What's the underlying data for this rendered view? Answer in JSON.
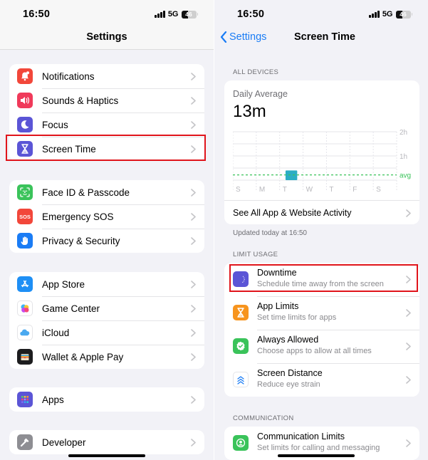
{
  "status_bar": {
    "time": "16:50",
    "network": "5G",
    "battery": "46"
  },
  "left": {
    "nav_title": "Settings",
    "groups": [
      {
        "items": [
          {
            "label": "Notifications",
            "icon": "bell-icon",
            "color": "#f2473a"
          },
          {
            "label": "Sounds & Haptics",
            "icon": "speaker-icon",
            "color": "#f03a5a"
          },
          {
            "label": "Focus",
            "icon": "moon-icon",
            "color": "#5b55d6"
          },
          {
            "label": "Screen Time",
            "icon": "hourglass-icon",
            "color": "#5b55d6",
            "highlighted": true
          }
        ]
      },
      {
        "items": [
          {
            "label": "Face ID & Passcode",
            "icon": "faceid-icon",
            "color": "#3ac35a"
          },
          {
            "label": "Emergency SOS",
            "icon": "sos-icon",
            "color": "#f2473a",
            "icon_text": "SOS"
          },
          {
            "label": "Privacy & Security",
            "icon": "hand-icon",
            "color": "#1a7cf5"
          }
        ]
      },
      {
        "items": [
          {
            "label": "App Store",
            "icon": "appstore-icon",
            "color": "#1e8ff5"
          },
          {
            "label": "Game Center",
            "icon": "gamecenter-icon",
            "color": "#ffffff"
          },
          {
            "label": "iCloud",
            "icon": "cloud-icon",
            "color": "#ffffff"
          },
          {
            "label": "Wallet & Apple Pay",
            "icon": "wallet-icon",
            "color": "#1c1c1e"
          }
        ]
      },
      {
        "items": [
          {
            "label": "Apps",
            "icon": "apps-grid-icon",
            "color": "#5b55d6"
          }
        ]
      },
      {
        "items": [
          {
            "label": "Developer",
            "icon": "hammer-icon",
            "color": "#8e8e93"
          }
        ]
      }
    ]
  },
  "right": {
    "back_label": "Settings",
    "nav_title": "Screen Time",
    "all_devices_header": "ALL DEVICES",
    "daily_average_label": "Daily Average",
    "daily_average_value": "13m",
    "see_all_label": "See All App & Website Activity",
    "updated_text": "Updated today at 16:50",
    "limit_usage_header": "LIMIT USAGE",
    "limit_items": [
      {
        "title": "Downtime",
        "subtitle": "Schedule time away from the screen",
        "icon": "downtime-icon",
        "color": "#5b55d6",
        "highlighted": true
      },
      {
        "title": "App Limits",
        "subtitle": "Set time limits for apps",
        "icon": "hourglass-icon",
        "color": "#f7941d"
      },
      {
        "title": "Always Allowed",
        "subtitle": "Choose apps to allow at all times",
        "icon": "check-badge-icon",
        "color": "#3ac35a"
      },
      {
        "title": "Screen Distance",
        "subtitle": "Reduce eye strain",
        "icon": "chevrons-up-icon",
        "color": "#ffffff"
      }
    ],
    "communication_header": "COMMUNICATION",
    "communication_items": [
      {
        "title": "Communication Limits",
        "subtitle": "Set limits for calling and messaging",
        "icon": "person-circle-icon",
        "color": "#3ac35a"
      }
    ]
  },
  "chart_data": {
    "type": "bar",
    "title": "Daily Average",
    "categories": [
      "S",
      "M",
      "T",
      "W",
      "T",
      "F",
      "S"
    ],
    "values_minutes": [
      0,
      0,
      24,
      0,
      0,
      0,
      0
    ],
    "average_minutes": 13,
    "ylim_hours": [
      0,
      2
    ],
    "y_ticks": [
      "2h",
      "1h"
    ],
    "average_label": "avg",
    "bar_color": "#2aaec4",
    "avg_color": "#3ac35a",
    "grid": true
  }
}
